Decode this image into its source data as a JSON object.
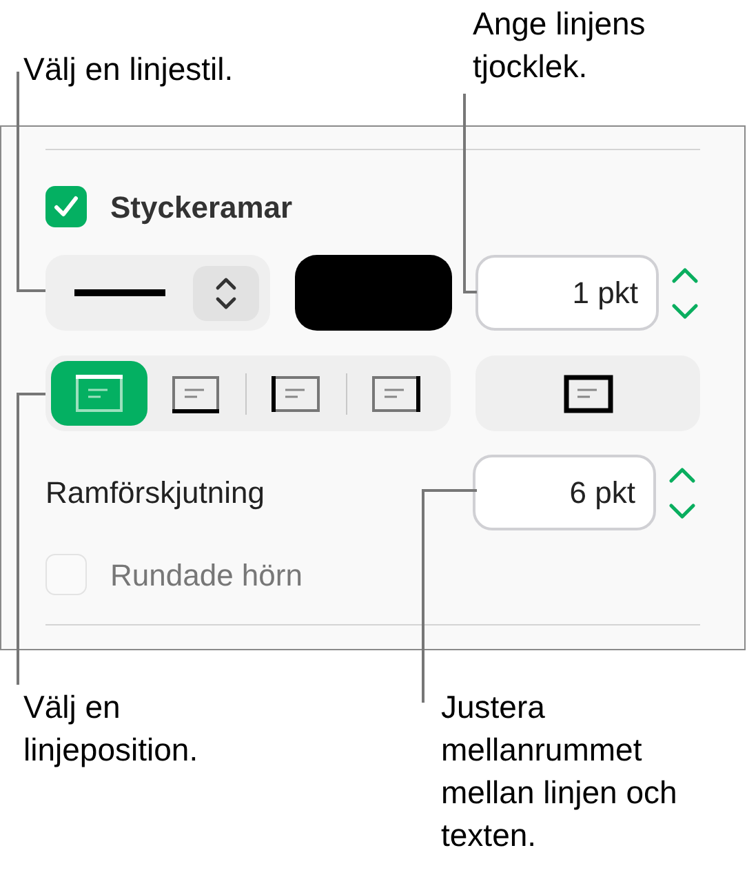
{
  "callouts": {
    "line_style": "Välj en linjestil.",
    "thickness": "Ange linjens tjocklek.",
    "position": "Välj en linjeposition.",
    "spacing": "Justera mellanrummet mellan linjen och texten."
  },
  "panel": {
    "borders_checkbox": {
      "label": "Styckeramar",
      "checked": true
    },
    "thickness": {
      "value": "1 pkt"
    },
    "positions": [
      {
        "kind": "top",
        "selected": true
      },
      {
        "kind": "bottom",
        "selected": false
      },
      {
        "kind": "left",
        "selected": false
      },
      {
        "kind": "right",
        "selected": false
      }
    ],
    "all_sides": {
      "kind": "all",
      "selected": false
    },
    "offset": {
      "label": "Ramförskjutning",
      "value": "6 pkt"
    },
    "rounded_checkbox": {
      "label": "Rundade hörn",
      "checked": false,
      "disabled": true
    }
  }
}
